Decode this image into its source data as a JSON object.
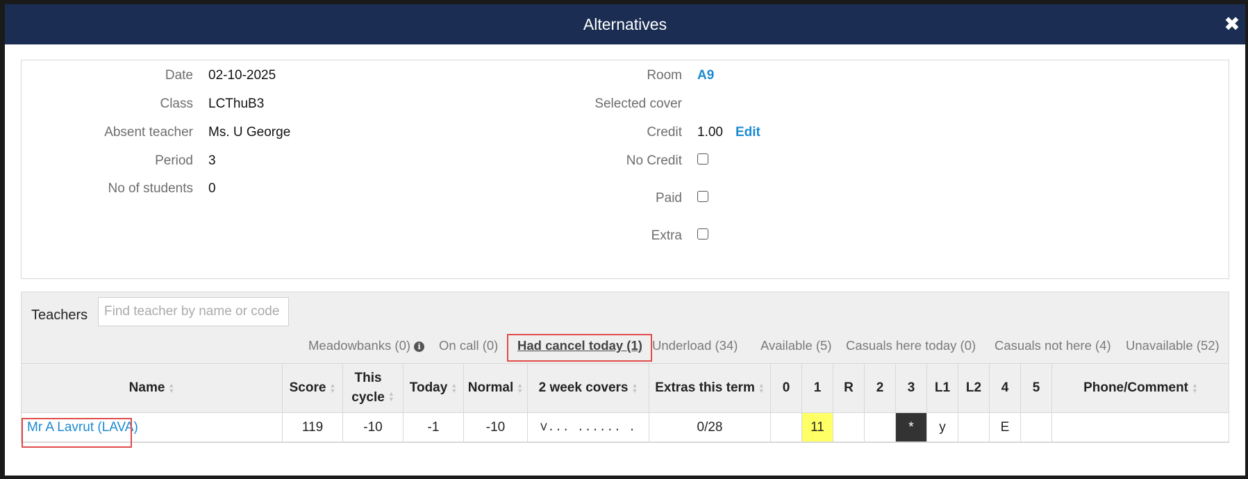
{
  "modal": {
    "title": "Alternatives"
  },
  "details": {
    "left": [
      {
        "label": "Date",
        "value": "02-10-2025"
      },
      {
        "label": "Class",
        "value": "LCThuB3"
      },
      {
        "label": "Absent teacher",
        "value": "Ms. U George"
      },
      {
        "label": "Period",
        "value": "3"
      },
      {
        "label": "No of students",
        "value": "0"
      }
    ],
    "room": {
      "label": "Room",
      "value": "A9"
    },
    "selected_cover": {
      "label": "Selected cover",
      "value": ""
    },
    "credit": {
      "label": "Credit",
      "value": "1.00",
      "edit_label": "Edit"
    },
    "no_credit": {
      "label": "No Credit",
      "checked": false
    },
    "paid": {
      "label": "Paid",
      "checked": false
    },
    "extra": {
      "label": "Extra",
      "checked": false
    }
  },
  "teachers": {
    "label": "Teachers",
    "search_placeholder": "Find teacher by name or code",
    "tabs": [
      {
        "label": "Meadowbanks (0)",
        "active": false
      },
      {
        "label": "On call (0)",
        "active": false
      },
      {
        "label": "Had cancel today (1)",
        "active": true
      },
      {
        "label": "Underload (34)",
        "active": false
      },
      {
        "label": "Available (5)",
        "active": false
      },
      {
        "label": "Casuals here today (0)",
        "active": false
      },
      {
        "label": "Casuals not here (4)",
        "active": false
      },
      {
        "label": "Unavailable (52)",
        "active": false
      }
    ],
    "columns": {
      "name": "Name",
      "score": "Score",
      "this_cycle_1": "This",
      "this_cycle_2": "cycle",
      "today": "Today",
      "normal": "Normal",
      "two_week": "2 week covers",
      "extras": "Extras this term",
      "p0": "0",
      "p1": "1",
      "pR": "R",
      "p2": "2",
      "p3": "3",
      "pL1": "L1",
      "pL2": "L2",
      "p4": "4",
      "p5": "5",
      "phone": "Phone/Comment"
    },
    "rows": [
      {
        "name": "Mr A Lavrut (LAVA)",
        "score": "119",
        "this_cycle": "-10",
        "today": "-1",
        "normal": "-10",
        "two_week": "V... ...... .",
        "extras": "0/28",
        "p0": "",
        "p1": "11",
        "pR": "",
        "p2": "",
        "p3": "*",
        "pL1": "y",
        "pL2": "",
        "p4": "E",
        "p5": "",
        "phone": ""
      }
    ]
  },
  "colors": {
    "header_bg": "#1b2d52",
    "link": "#1b8ad0",
    "highlight_box": "#e04a4a",
    "period_highlight": "#ffff66"
  }
}
